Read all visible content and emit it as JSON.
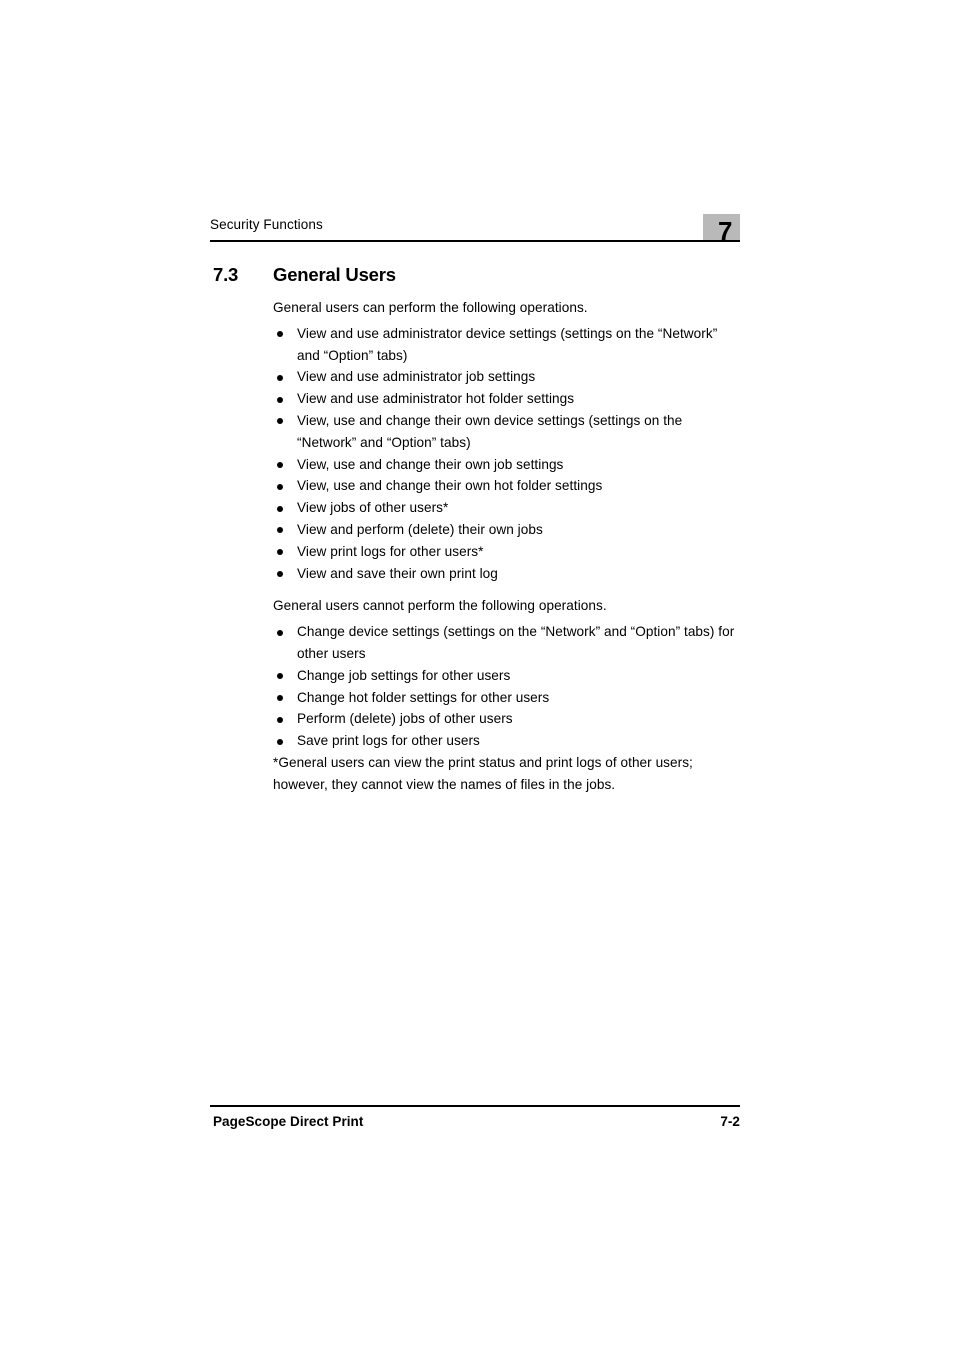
{
  "header": {
    "running_title": "Security Functions",
    "chapter_number": "7",
    "chapter_tab_color": "#b9b9b9"
  },
  "section": {
    "number": "7.3",
    "title": "General Users"
  },
  "body": {
    "can_intro": "General users can perform the following operations.",
    "can_items": [
      "View and use administrator device settings (settings on the “Network” and “Option” tabs)",
      "View and use administrator job settings",
      "View and use administrator hot folder settings",
      "View, use and change their own device settings (settings on the “Network” and “Option” tabs)",
      "View, use and change their own job settings",
      "View, use and change their own hot folder settings",
      "View jobs of other users*",
      "View and perform (delete) their own jobs",
      "View print logs for other users*",
      "View and save their own print log"
    ],
    "cannot_intro": "General users cannot perform the following operations.",
    "cannot_items": [
      "Change device settings (settings on the “Network” and “Option” tabs) for other users",
      "Change job settings for other users",
      "Change hot folder settings for other users",
      "Perform (delete) jobs of other users",
      "Save print logs for other users"
    ],
    "footnote": "*General users can view the print status and print logs of other users; however, they cannot view the names of files in the jobs."
  },
  "footer": {
    "document_title": "PageScope Direct Print",
    "page_number": "7-2"
  }
}
